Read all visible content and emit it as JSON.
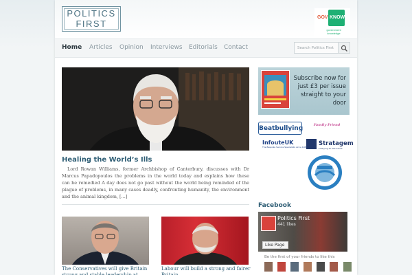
{
  "site": {
    "logo_line1": "POLITICS",
    "logo_line2": "FIRST",
    "logo_color": "#4d7383"
  },
  "partner_top": {
    "gov": "GOV",
    "know": "KNOW",
    "sub": "government knowledge"
  },
  "nav": {
    "items": [
      "Home",
      "Articles",
      "Opinion",
      "Interviews",
      "Editorials",
      "Contact"
    ],
    "active": "Home",
    "search_placeholder": "Search Politics First"
  },
  "feature": {
    "title": "Healing the World’s Ills",
    "excerpt": "Lord Rowan Williams, former Archbishop of Canterbury, discusses with Dr Marcus Papadopoulos the problems in the world today and explains how these can be remedied A day does not go past without the world being reminded of the plague of problems, in many cases deadly, confronting humanity, the environment and the animal kingdom, [...]"
  },
  "articles": [
    {
      "title": "The Conservatives will give Britain strong and stable leadership at what"
    },
    {
      "title": "Labour will build a strong and fairer Britain"
    }
  ],
  "sidebar": {
    "subscribe_text": "Subscribe now for just £3 per issue straight to your door",
    "partners": {
      "beatbullying": "Beatbullying",
      "friend": "Family Friend",
      "infoutreuk": "InfouteUK",
      "infoutreuk_sub": "The Bespoke Service Specialists since 1988",
      "stratagem": "Stratagem",
      "stratagem_sub": "Lobbying for the future"
    },
    "facebook_heading": "Facebook",
    "facebook": {
      "page_name": "Politics First",
      "likes": "441 likes",
      "like_button": "Like Page",
      "friends_text": "Be the first of your friends to like this"
    }
  },
  "colors": {
    "heading": "#2f5e75",
    "nav_text": "#8a98a0",
    "accent_green": "#1fb074"
  }
}
